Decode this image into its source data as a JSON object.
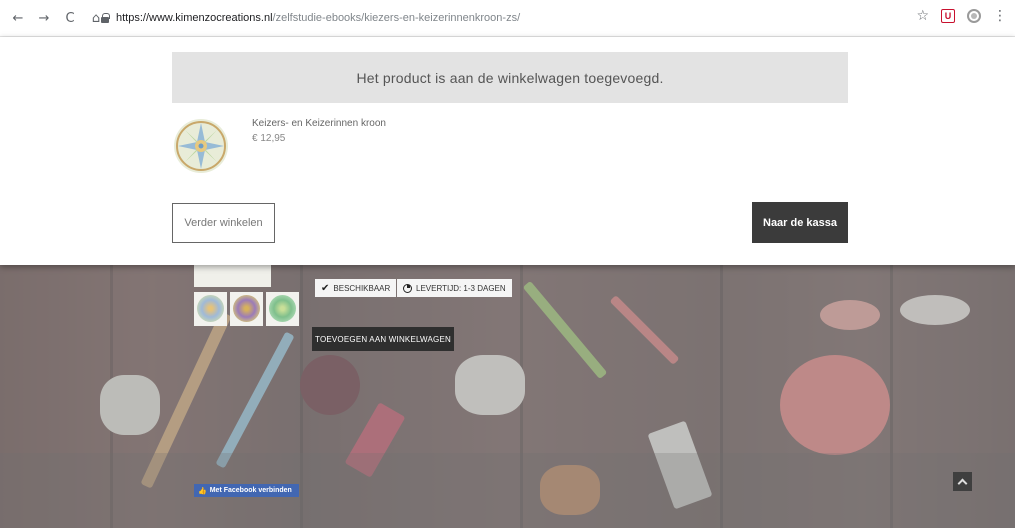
{
  "browser": {
    "back": "←",
    "forward": "→",
    "reload": "C",
    "home": "⌂",
    "url_host": "https://www.kimenzocreations.nl",
    "url_path": "/zelfstudie-ebooks/kiezers-en-keizerinnenkroon-zs/",
    "star": "☆",
    "ext_label": "U",
    "menu": "⋮"
  },
  "modal": {
    "notice": "Het product is aan de winkelwagen toegevoegd.",
    "product_name": "Keizers- en Keizerinnen kroon",
    "product_price": "€ 12,95",
    "continue_label": "Verder winkelen",
    "checkout_label": "Naar de kassa"
  },
  "product_page": {
    "availability": "BESCHIKBAAR",
    "delivery": "LEVERTIJD: 1-3 DAGEN",
    "add_to_cart": "TOEVOEGEN AAN WINKELWAGEN",
    "facebook_connect": "Met Facebook verbinden",
    "check_glyph": "✔",
    "thumb_glyph": "👍"
  },
  "colors": {
    "checkout_bg": "#3b3b3b",
    "notice_bg": "#e3e3e3",
    "facebook_blue": "#4267b2"
  }
}
